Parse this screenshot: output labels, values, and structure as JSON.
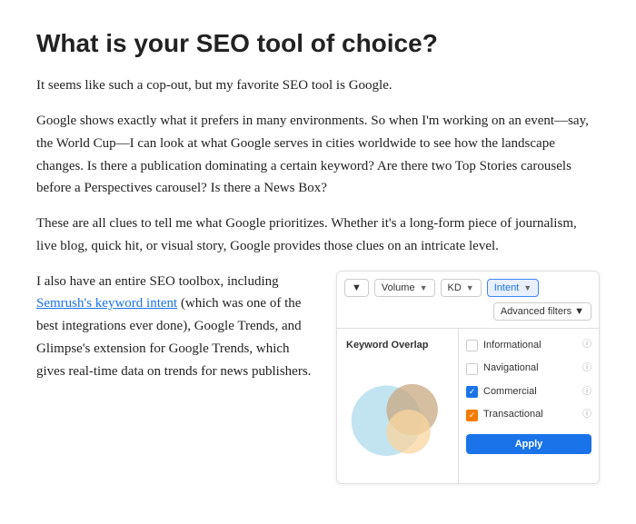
{
  "heading": "What is your SEO tool of choice?",
  "paragraph1": "It seems like such a cop-out, but my favorite SEO tool is Google.",
  "paragraph2": "Google shows exactly what it prefers in many environments. So when I'm working on an event—say, the World Cup—I can look at what Google serves in cities worldwide to see how the landscape changes. Is there a publication dominating a certain keyword? Are there two Top Stories carousels before a Perspectives carousel? Is there a News Box?",
  "paragraph3": "These are all clues to tell me what Google prioritizes. Whether it's a long-form piece of journalism, live blog, quick hit, or visual story, Google provides those clues on an intricate level.",
  "paragraph4_start": "I also have an entire SEO toolbox, including ",
  "link_text": "Semrush's keyword intent",
  "paragraph4_end": " (which was one of the best integrations ever done), Google Trends, and Glimpse's extension for Google Trends, which gives real-time data on trends for news publishers.",
  "seo_ui": {
    "filters": {
      "volume_label": "Volume",
      "kd_label": "KD",
      "intent_label": "Intent",
      "advanced_label": "Advanced filters"
    },
    "chart_title": "Keyword Overlap",
    "dropdown_items": [
      {
        "label": "Informational",
        "checked": false,
        "check_color": "none"
      },
      {
        "label": "Navigational",
        "checked": false,
        "check_color": "none"
      },
      {
        "label": "Commercial",
        "checked": true,
        "check_color": "blue"
      },
      {
        "label": "Transactional",
        "checked": true,
        "check_color": "orange"
      }
    ],
    "apply_button": "Apply"
  }
}
